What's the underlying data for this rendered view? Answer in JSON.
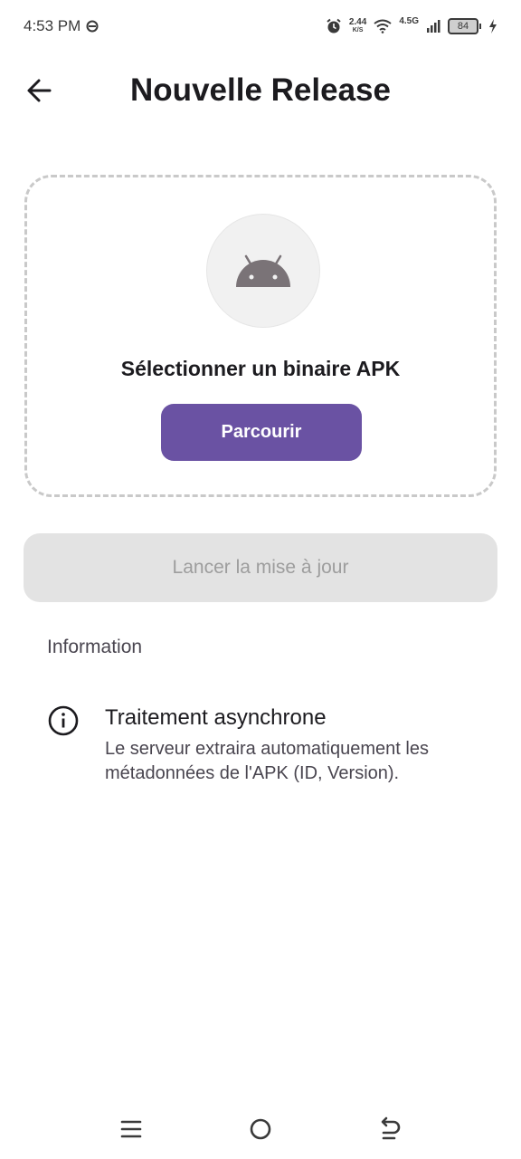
{
  "status_bar": {
    "time": "4:53 PM",
    "net_speed_value": "2.44",
    "net_speed_unit": "K/S",
    "network_type": "4.5G",
    "battery_level": "84",
    "icons": [
      "alarm-icon",
      "wifi-icon",
      "signal-icon",
      "battery-icon",
      "charging-icon"
    ]
  },
  "app_bar": {
    "title": "Nouvelle Release",
    "back_icon": "arrow-left-icon"
  },
  "upload_card": {
    "icon": "android-icon",
    "title": "Sélectionner un binaire APK",
    "browse_label": "Parcourir"
  },
  "launch_button": {
    "label": "Lancer la mise à jour",
    "enabled": false
  },
  "info_section": {
    "header": "Information",
    "item": {
      "icon": "info-icon",
      "title": "Traitement asynchrone",
      "description": "Le serveur extraira automatiquement les métadonnées de l'APK (ID, Version)."
    }
  },
  "colors": {
    "accent": "#6a52a3",
    "disabled_bg": "#e3e3e3",
    "disabled_text": "#9d9d9d",
    "dashed_border": "#c9c9c9"
  },
  "nav_bar": {
    "icons": [
      "menu-icon",
      "home-icon",
      "back-icon"
    ]
  }
}
